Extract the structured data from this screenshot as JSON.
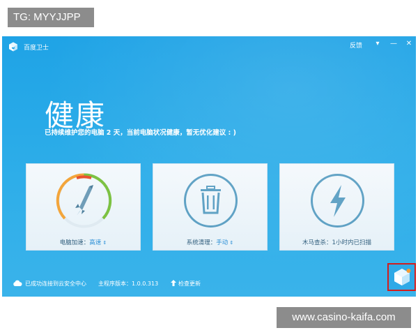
{
  "watermarks": {
    "top": "TG: MYYJJPP",
    "bottom": "www.casino-kaifa.com"
  },
  "titlebar": {
    "title": "百度卫士",
    "feedback": "反馈",
    "menu": "▾",
    "minimize": "—",
    "close": "✕"
  },
  "status": {
    "title": "健康",
    "subtitle": "已持续维护您的电脑 2 天，当前电脑状况健康，暂无优化建议 : )"
  },
  "cards": [
    {
      "name": "电脑加速：",
      "value": "高速",
      "icon": "rocket-icon"
    },
    {
      "name": "系统清理：",
      "value": "手动",
      "icon": "trash-icon"
    },
    {
      "name": "木马查杀：1小时内已扫描",
      "value": "",
      "icon": "lightning-icon"
    }
  ],
  "footer": {
    "cloud": "已成功连接到云安全中心",
    "version": "主程序版本：1.0.0.313",
    "update": "检查更新"
  },
  "colors": {
    "window": "#2eaee9",
    "card": "#eef5fa",
    "ring": "#5b9fc3",
    "accent": "#2b8fd6",
    "highlight": "#d21d1d"
  }
}
